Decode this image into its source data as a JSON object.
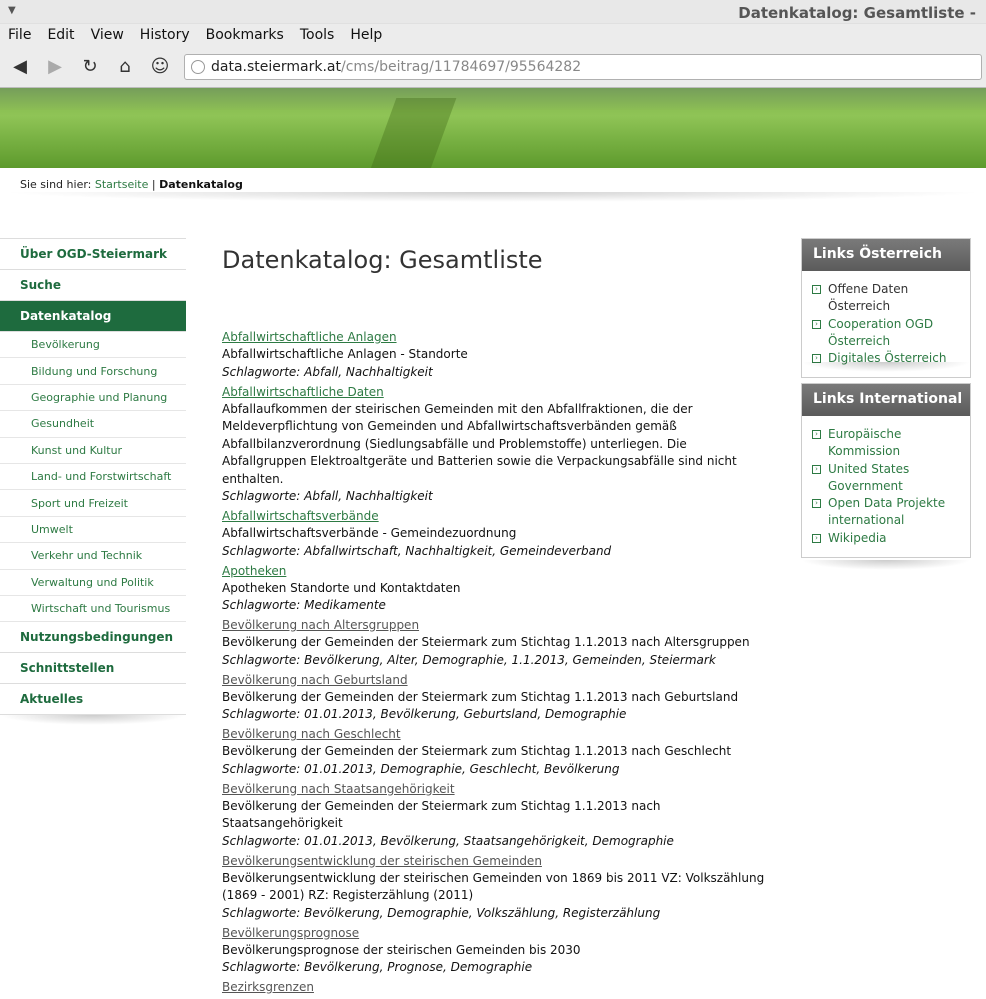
{
  "browser": {
    "window_title": "Datenkatalog: Gesamtliste -",
    "menu": [
      "File",
      "Edit",
      "View",
      "History",
      "Bookmarks",
      "Tools",
      "Help"
    ],
    "url_domain": "data.steiermark.at",
    "url_path": "/cms/beitrag/11784697/95564282"
  },
  "breadcrumb": {
    "prefix": "Sie sind hier:",
    "home": "Startseite",
    "separator": "|",
    "current": "Datenkatalog"
  },
  "sidebar": {
    "items": [
      {
        "label": "Über OGD-Steiermark"
      },
      {
        "label": "Suche"
      },
      {
        "label": "Datenkatalog"
      }
    ],
    "subitems": [
      "Bevölkerung",
      "Bildung und Forschung",
      "Geographie und Planung",
      "Gesundheit",
      "Kunst und Kultur",
      "Land- und Forstwirtschaft",
      "Sport und Freizeit",
      "Umwelt",
      "Verkehr und Technik",
      "Verwaltung und Politik",
      "Wirtschaft und Tourismus"
    ],
    "bottom_items": [
      {
        "label": "Nutzungsbedingungen"
      },
      {
        "label": "Schnittstellen"
      },
      {
        "label": "Aktuelles"
      }
    ]
  },
  "main": {
    "title": "Datenkatalog: Gesamtliste",
    "entries": [
      {
        "title": "Abfallwirtschaftliche Anlagen",
        "desc": "Abfallwirtschaftliche Anlagen - Standorte",
        "keywords": "Schlagworte: Abfall, Nachhaltigkeit"
      },
      {
        "title": "Abfallwirtschaftliche Daten",
        "desc": "Abfallaufkommen der steirischen Gemeinden mit den Abfallfraktionen, die der Meldeverpflichtung von Gemeinden und Abfallwirtschaftsverbänden gemäß Abfallbilanzverordnung (Siedlungsabfälle und Problemstoffe) unterliegen. Die Abfallgruppen Elektroaltgeräte und Batterien sowie die Verpackungsabfälle sind nicht enthalten.",
        "keywords": "Schlagworte: Abfall, Nachhaltigkeit"
      },
      {
        "title": "Abfallwirtschaftsverbände",
        "desc": "Abfallwirtschaftsverbände - Gemeindezuordnung",
        "keywords": "Schlagworte: Abfallwirtschaft, Nachhaltigkeit, Gemeindeverband"
      },
      {
        "title": "Apotheken",
        "desc": "Apotheken Standorte und Kontaktdaten",
        "keywords": "Schlagworte: Medikamente"
      },
      {
        "title": "Bevölkerung nach Altersgruppen",
        "desc": "Bevölkerung der Gemeinden der Steiermark zum Stichtag 1.1.2013 nach Altersgruppen",
        "keywords": "Schlagworte: Bevölkerung, Alter, Demographie, 1.1.2013, Gemeinden, Steiermark"
      },
      {
        "title": "Bevölkerung nach Geburtsland",
        "desc": "Bevölkerung der Gemeinden der Steiermark zum Stichtag 1.1.2013 nach Geburtsland",
        "keywords": "Schlagworte: 01.01.2013, Bevölkerung, Geburtsland, Demographie"
      },
      {
        "title": "Bevölkerung nach Geschlecht",
        "desc": "Bevölkerung der Gemeinden der Steiermark zum Stichtag 1.1.2013 nach Geschlecht",
        "keywords": "Schlagworte: 01.01.2013, Demographie, Geschlecht, Bevölkerung"
      },
      {
        "title": "Bevölkerung nach Staatsangehörigkeit",
        "desc": "Bevölkerung der Gemeinden der Steiermark zum Stichtag 1.1.2013 nach Staatsangehörigkeit",
        "keywords": "Schlagworte: 01.01.2013, Bevölkerung, Staatsangehörigkeit, Demographie"
      },
      {
        "title": "Bevölkerungsentwicklung der steirischen Gemeinden",
        "desc": "Bevölkerungsentwicklung der steirischen Gemeinden von 1869 bis 2011 VZ: Volkszählung (1869 - 2001) RZ: Registerzählung (2011)",
        "keywords": "Schlagworte: Bevölkerung, Demographie, Volkszählung, Registerzählung"
      },
      {
        "title": "Bevölkerungsprognose",
        "desc": "Bevölkerungsprognose der steirischen Gemeinden bis 2030",
        "keywords": "Schlagworte: Bevölkerung, Prognose, Demographie"
      },
      {
        "title": "Bezirksgrenzen",
        "desc": "",
        "keywords": ""
      }
    ]
  },
  "links_at": {
    "title": "Links Österreich",
    "items": [
      "Offene Daten Österreich",
      "Cooperation OGD Österreich",
      "Digitales Österreich"
    ]
  },
  "links_int": {
    "title": "Links International",
    "items": [
      "Europäische Kommission",
      "United States Government",
      "Open Data Projekte international",
      "Wikipedia"
    ]
  }
}
